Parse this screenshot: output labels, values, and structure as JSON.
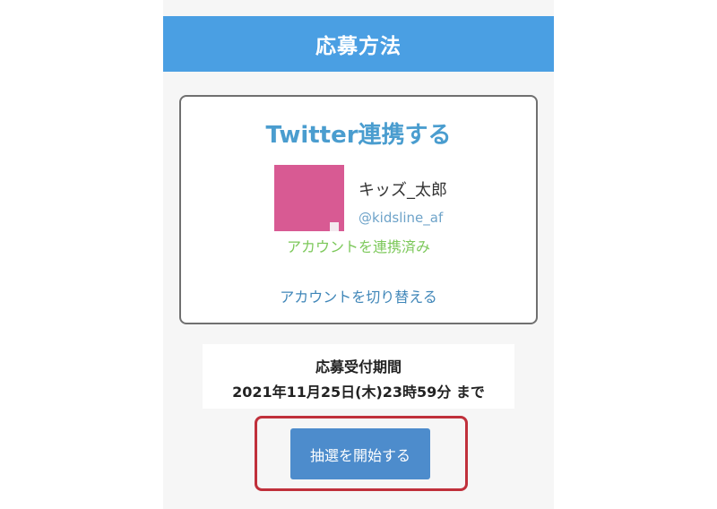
{
  "header": {
    "title": "応募方法"
  },
  "twitter_card": {
    "title": "Twitter連携する",
    "user_name": "キッズ_太郎",
    "user_handle": "@kidsline_af",
    "linked_status": "アカウントを連携済み",
    "switch_account_label": "アカウントを切り替える",
    "avatar_color": "#d85a93"
  },
  "entry_period": {
    "label": "応募受付期間",
    "value": "2021年11月25日(木)23時59分 まで"
  },
  "actions": {
    "start_lottery_label": "抽選を開始する",
    "button_color": "#4d8ccc",
    "highlight_color": "#c0303b"
  },
  "colors": {
    "header_bg": "#4a9fe3",
    "title_color": "#4a9dcf",
    "linked_color": "#7cc85a",
    "link_color": "#3f86b8"
  }
}
